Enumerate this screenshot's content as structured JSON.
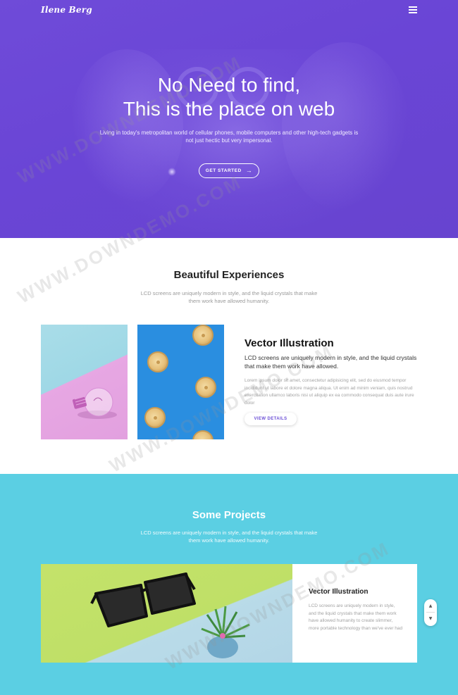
{
  "brand": {
    "logo_text": "Ilene Berg"
  },
  "hero": {
    "title_line1": "No Need to find,",
    "title_line2": "This is the place on web",
    "subtitle": "Living in today's metropolitan world of cellular phones, mobile computers and other high-tech gadgets is not just hectic but very impersonal.",
    "cta_label": "GET STARTED",
    "cta_icon": "arrow-right-icon",
    "bg_color": "#6a45d6"
  },
  "experiences": {
    "title": "Beautiful Experiences",
    "description": "LCD screens are uniquely modern in style, and the liquid crystals that make them work have allowed humanity.",
    "card": {
      "title": "Vector Illustration",
      "lead": "LCD screens are uniquely modern in style, and the liquid crystals that make them work have allowed.",
      "body": "Lorem ipsum dolor sit amet, consectetur adipisicing elit, sed do eiusmod tempor incididunt ut labore et dolore magna aliqua. Ut enim ad minim veniam, quis nostrud exercitation ullamco laboris nisi ut aliquip ex ea commodo consequat duis aute irure dolor",
      "button_label": "VIEW DETAILS"
    }
  },
  "projects": {
    "title": "Some Projects",
    "description": "LCD screens are uniquely modern in style, and the liquid crystals that make them work have allowed humanity.",
    "bg_color": "#5bcfe3",
    "item": {
      "title": "Vector Illustration",
      "body": "LCD screens are uniquely modern in style, and the liquid crystals that make them work have allowed humanity to create slimmer, more portable technology than we've ever had"
    },
    "scroll_up_icon": "chevron-up-icon",
    "scroll_down_icon": "chevron-down-icon"
  },
  "watermark": {
    "text": "WWW.DOWNDEMO.COM"
  },
  "colors": {
    "accent": "#6b4fd6",
    "cyan": "#5bcfe3"
  }
}
